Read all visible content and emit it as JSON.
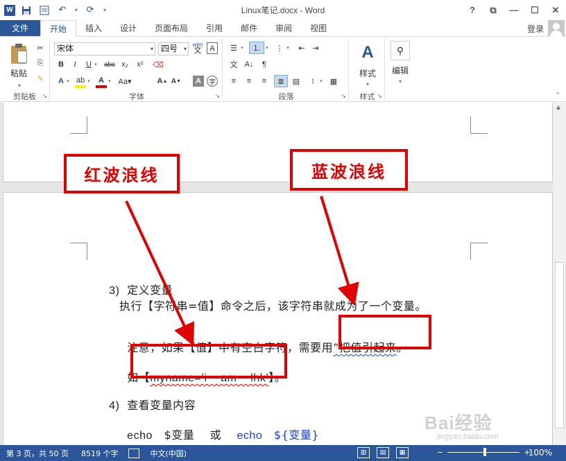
{
  "window": {
    "title": "Linux笔记.docx - Word",
    "help": "?",
    "restore_ribbon": "⧉",
    "minimize": "—",
    "maximize": "☐",
    "close": "✕"
  },
  "qat": {
    "app_icon": "W"
  },
  "tabs": {
    "file": "文件",
    "items": [
      "开始",
      "插入",
      "设计",
      "页面布局",
      "引用",
      "邮件",
      "审阅",
      "视图"
    ],
    "active_index": 0,
    "login": "登录"
  },
  "ribbon": {
    "clipboard": {
      "paste": "粘贴",
      "label": "剪贴板"
    },
    "font": {
      "font_name": "宋体",
      "font_size": "四号",
      "wen": "wén",
      "a_box": "A",
      "bold": "B",
      "italic": "I",
      "underline": "U",
      "strike": "abc",
      "sub": "x₂",
      "sup": "x²",
      "label": "字体"
    },
    "paragraph": {
      "label": "段落"
    },
    "styles": {
      "button": "样式",
      "label": "样式"
    },
    "editing": {
      "button": "编辑"
    }
  },
  "document": {
    "item3_num": "3)",
    "item3_title": "定义变量",
    "line1": "执行【字符串=值】命令之后，该字符串就成为了一个变量。",
    "line2_prefix": "注意，如果【值】中有空白字符，需要用",
    "line2_wavy": "”把值引起来",
    "line2_suffix": "。",
    "line3_prefix": "如【",
    "line3_wavy": "myname=’i    am    lhk’",
    "line3_suffix": "】。",
    "item4_num": "4)",
    "item4_title": "查看变量内容",
    "echo1": "echo",
    "echo1_arg": "$变量",
    "or": "或",
    "echo2": "echo",
    "echo2_arg": "${变量}"
  },
  "annotations": {
    "red_label": "红波浪线",
    "blue_label": "蓝波浪线",
    "color": "#e10000"
  },
  "statusbar": {
    "page": "第 3 页，共 50 页",
    "words": "8519 个字",
    "lang": "中文(中国)",
    "zoom": "100%",
    "zoom_minus": "−",
    "zoom_plus": "+"
  },
  "watermark": {
    "text": "Bai经验",
    "url": "jingyan.baidu.com"
  },
  "colors": {
    "accent": "#2b579a",
    "red": "#e10000",
    "blue": "#1a3fd8"
  }
}
